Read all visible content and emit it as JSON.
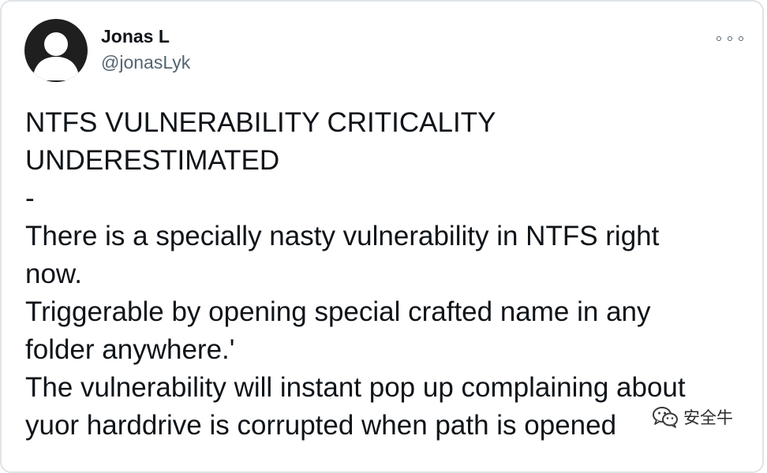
{
  "tweet": {
    "author": {
      "display_name": "Jonas L",
      "handle": "@jonasLyk",
      "avatar": "default-avatar-icon"
    },
    "menu": {
      "icon": "more-options-icon"
    },
    "body_lines": [
      "NTFS VULNERABILITY CRITICALITY",
      "UNDERESTIMATED",
      "-",
      "There is a specially nasty vulnerability in NTFS right",
      "now.",
      "Triggerable by opening special crafted name in any",
      "folder anywhere.'",
      "The vulnerability will instant pop up complaining about",
      "yuor harddrive is corrupted when path is opened"
    ]
  },
  "watermark": {
    "text": "安全牛",
    "icon": "wechat-logo-icon"
  },
  "colors": {
    "text_primary": "#0f1419",
    "text_secondary": "#536471",
    "card_border": "#dfe4e8",
    "avatar_bg": "#1f1f1f"
  }
}
